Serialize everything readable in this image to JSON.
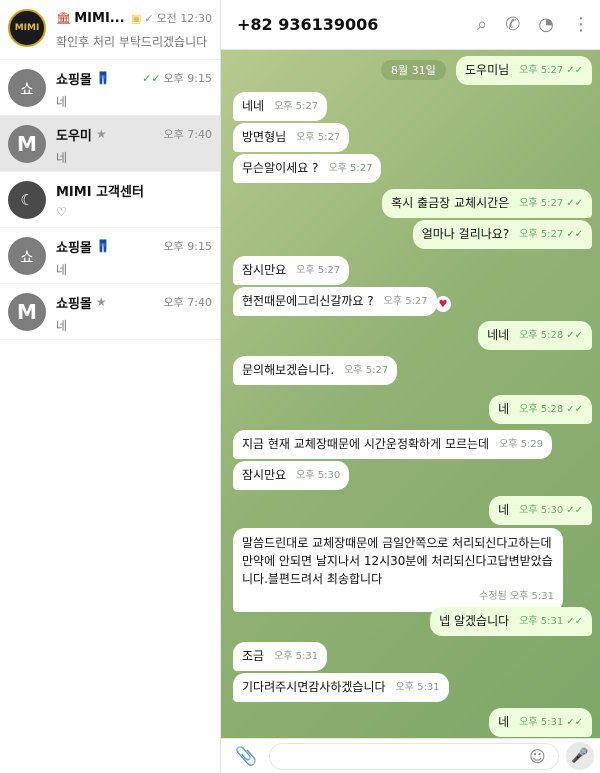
{
  "sidebar": {
    "chats": [
      {
        "name": "MIMI...",
        "tag": "",
        "time": "오전 12:30",
        "preview": "확인후 처리 부탁드리겠습니다",
        "avatar": "MIMI"
      },
      {
        "name": "쇼핑몰",
        "tag": "👖",
        "time": "오후 9:15",
        "preview": "네",
        "avatar": "쇼"
      },
      {
        "name": "도우미",
        "tag": "★",
        "time": "오후 7:40",
        "preview": "네",
        "avatar": "M"
      },
      {
        "name": "MIMI 고객센터",
        "tag": "",
        "time": "",
        "preview": "♡",
        "avatar": "☾"
      },
      {
        "name": "쇼핑몰",
        "tag": "👖",
        "time": "오후 9:15",
        "preview": "네",
        "avatar": "쇼"
      },
      {
        "name": "쇼핑몰",
        "tag": "★",
        "time": "오후 7:40",
        "preview": "네",
        "avatar": "M"
      }
    ]
  },
  "header": {
    "title": "+82 936139006"
  },
  "date_chip": "8월 31일",
  "messages": [
    {
      "dir": "out",
      "text": "도우미님",
      "time": "오후 5:27"
    },
    {
      "dir": "in",
      "text": "네네",
      "time": "오후 5:27"
    },
    {
      "dir": "in",
      "text": "방면형님",
      "time": "오후 5:27"
    },
    {
      "dir": "in",
      "text": "무슨알이세요 ?",
      "time": "오후 5:27"
    },
    {
      "dir": "out",
      "text": "혹시 출금장 교체시간은",
      "time": "오후 5:27"
    },
    {
      "dir": "out",
      "text": "얼마나 걸리나요?",
      "time": "오후 5:27"
    },
    {
      "dir": "in",
      "text": "잠시만요",
      "time": "오후 5:27"
    },
    {
      "dir": "in",
      "text": "현전때문에그리신갈까요 ?",
      "time": "오후 5:27"
    },
    {
      "dir": "out",
      "text": "네네",
      "time": "오후 5:28"
    },
    {
      "dir": "in",
      "text": "문의해보겠습니다.",
      "time": "오후 5:27"
    },
    {
      "dir": "out",
      "text": "네",
      "time": "오후 5:28"
    },
    {
      "dir": "in",
      "text": "지금 현재 교체장때문에 시간운정확하게 모르는데",
      "time": "오후 5:29"
    },
    {
      "dir": "in",
      "text": "잠시만요",
      "time": "오후 5:30"
    },
    {
      "dir": "out",
      "text": "네",
      "time": "오후 5:30"
    },
    {
      "dir": "in",
      "text": "말씀드린대로 교체장때문에 금일안쪽으로 처리되신다고하는데 만약에 안되면 날지나서 12시30분에 처리되신다고답변받았습니다.블편드려서 최송합니다",
      "time": "수정됨 오후 5:31"
    },
    {
      "dir": "out",
      "text": "넵 알겠습니다",
      "time": "오후 5:31"
    },
    {
      "dir": "in",
      "text": "조금",
      "time": "오후 5:31"
    },
    {
      "dir": "in",
      "text": "기다려주시면감사하겠습니다",
      "time": "오후 5:31"
    },
    {
      "dir": "out",
      "text": "네",
      "time": "오후 5:31"
    }
  ],
  "input": {
    "placeholder": ""
  },
  "icons": [
    "search-icon",
    "phone-icon",
    "call-history-icon",
    "more-icon",
    "attach-icon",
    "emoji-icon",
    "mic-icon"
  ],
  "colors": {
    "chat_bg": "#93b275",
    "outgoing": "#eefedd",
    "incoming": "#ffffff",
    "check": "#5aac5a"
  }
}
